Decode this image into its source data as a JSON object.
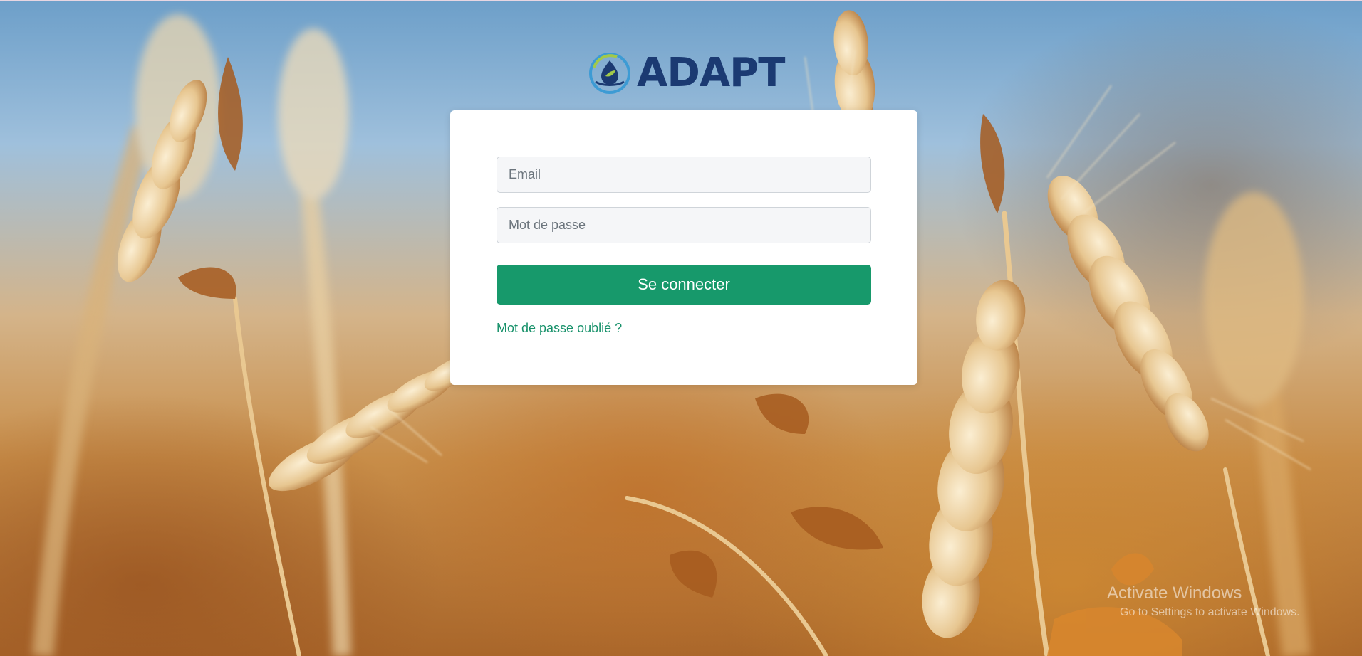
{
  "brand": {
    "name": "ADAPT",
    "logo_icon": "leaf-drop-globe-icon",
    "colors": {
      "text": "#1b3a72",
      "ring": "#3d9bd4",
      "leaf": "#a2c94a"
    }
  },
  "login": {
    "email_placeholder": "Email",
    "password_placeholder": "Mot de passe",
    "submit_label": "Se connecter",
    "forgot_label": "Mot de passe oublié ?",
    "colors": {
      "button": "#17996b",
      "link": "#17916a"
    }
  },
  "background": {
    "description_icon": "wheat-field-image"
  },
  "watermark": {
    "title": "Activate Windows",
    "subtitle": "Go to Settings to activate Windows."
  }
}
